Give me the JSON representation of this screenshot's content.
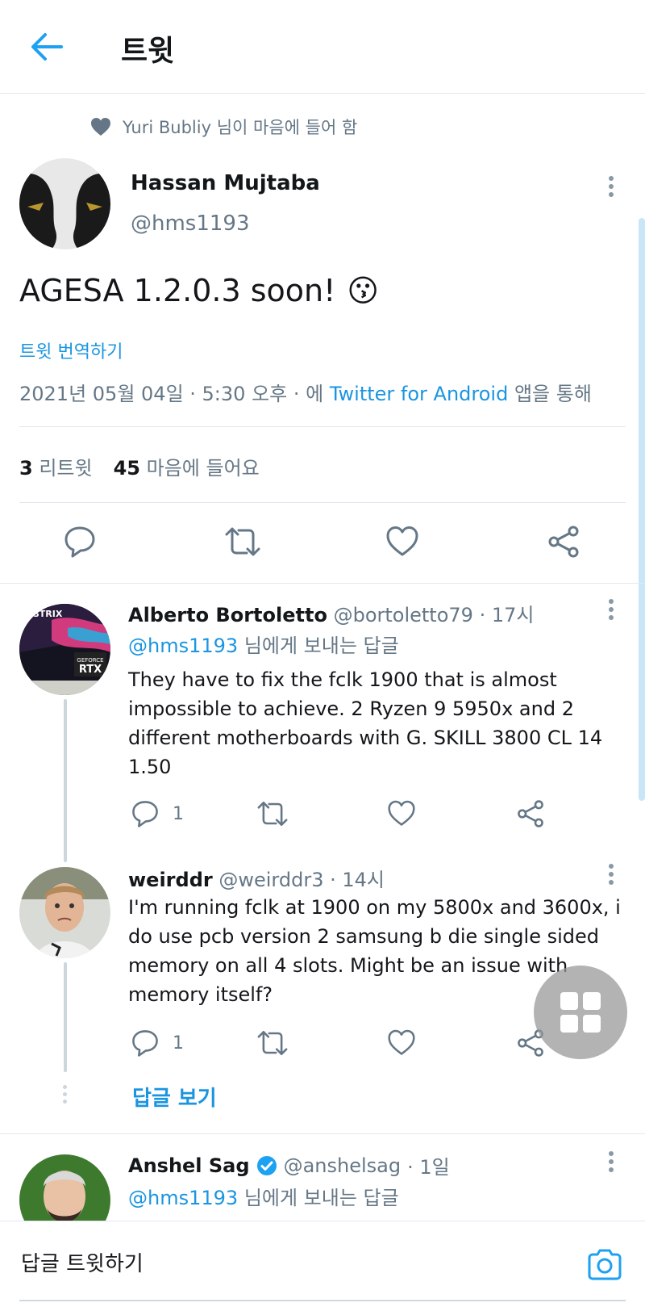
{
  "header": {
    "title": "트윗"
  },
  "liked_by": {
    "text": "Yuri Bubliy 님이 마음에 들어 함"
  },
  "main_tweet": {
    "author_name": "Hassan Mujtaba",
    "author_handle": "@hms1193",
    "text": "AGESA 1.2.0.3 soon!",
    "emoji": "😗",
    "translate_label": "트윗 번역하기",
    "timestamp": "2021년 05월 04일 · 5:30 오후 · 에",
    "source": "Twitter for Android",
    "source_suffix": "앱을 통해",
    "retweet_count": "3",
    "retweet_label": "리트윗",
    "like_count": "45",
    "like_label": "마음에 들어요"
  },
  "replies": [
    {
      "name": "Alberto Bortoletto",
      "handle": "@bortoletto79",
      "time": "· 17시",
      "replying_to_handle": "@hms1193",
      "replying_to_suffix": "님에게 보내는 답글",
      "text": "They have to fix the fclk 1900  that is almost impossible to achieve. 2 Ryzen 9 5950x and 2 different motherboards with G. SKILL 3800 CL 14 1.50",
      "reply_count": "1",
      "avatar_text": "GEFORCE RTX"
    },
    {
      "name": "weirddr",
      "handle": "@weirddr3",
      "time": "· 14시",
      "text": "I'm running fclk at 1900 on my 5800x and 3600x, i do use pcb version 2 samsung b die single sided memory on all 4 slots. Might be an issue with memory itself?",
      "reply_count": "1"
    },
    {
      "name": "Anshel Sag",
      "handle": "@anshelsag",
      "time": "· 1일",
      "replying_to_handle": "@hms1193",
      "replying_to_suffix": "님에게 보내는 답글"
    }
  ],
  "show_replies_label": "답글 보기",
  "bottom_bar": {
    "reply_placeholder": "답글 트윗하기"
  },
  "colors": {
    "accent": "#1b95e0",
    "muted": "#657786",
    "divider": "#e1e8ed"
  }
}
